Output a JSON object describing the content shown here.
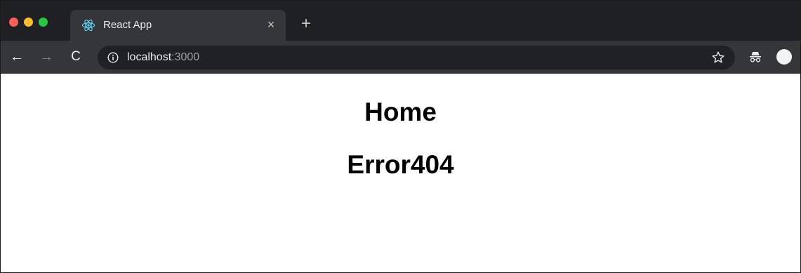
{
  "browser": {
    "tab": {
      "title": "React App",
      "icon": "react-logo-icon",
      "close": "×"
    },
    "new_tab": "+",
    "nav": {
      "back": "←",
      "forward": "→",
      "reload": "C"
    },
    "address": {
      "host": "localhost",
      "port": ":3000"
    },
    "colors": {
      "tabstrip": "#1f2023",
      "toolbar": "#35363a",
      "omnibox": "#202124"
    }
  },
  "page": {
    "headings": [
      "Home",
      "Error404"
    ]
  }
}
